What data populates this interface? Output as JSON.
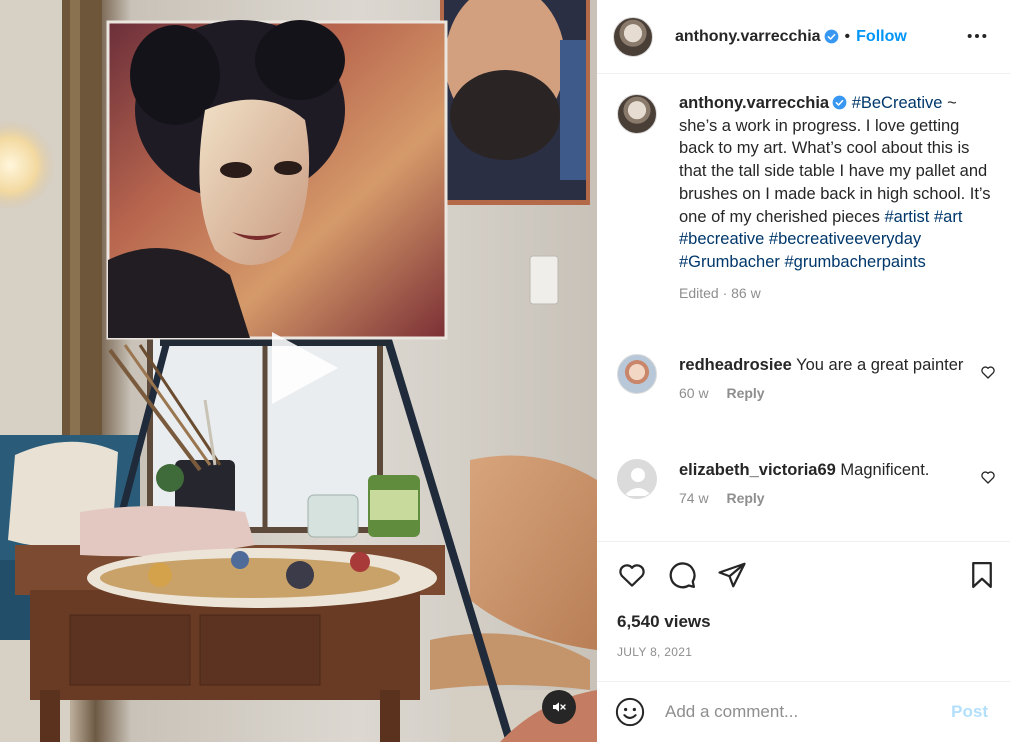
{
  "post": {
    "username": "anthony.varrecchia",
    "follow_label": "Follow",
    "separator": "•",
    "caption_hashtag_lead": "#BeCreative",
    "caption_text": " ~ she’s a work in progress. I love getting back to my art. What’s cool about this is that the tall side table I have my pallet and brushes on I made back in high school. It’s one of my cherished pieces ",
    "caption_tags": [
      "#artist",
      "#art",
      "#becreative",
      "#becreativeeveryday",
      "#Grumbacher",
      "#grumbacherpaints"
    ],
    "caption_meta": "Edited · 86 w"
  },
  "comments": [
    {
      "username": "redheadrosiee",
      "text": "You are a great painter",
      "time": "60 w",
      "reply_label": "Reply"
    },
    {
      "username": "elizabeth_victoria69",
      "text": "Magnificent.",
      "time": "74 w",
      "reply_label": "Reply"
    }
  ],
  "stats": {
    "views": "6,540 views",
    "date": "JULY 8, 2021"
  },
  "composer": {
    "placeholder": "Add a comment...",
    "post_label": "Post"
  },
  "colors": {
    "accent": "#0095f6",
    "hashtag": "#00376b",
    "muted": "#8e8e8e",
    "post_disabled": "#b2dffc"
  },
  "icons": {
    "media": [
      "play-icon",
      "mute-icon"
    ],
    "header": [
      "verified-badge-icon",
      "more-options-icon"
    ],
    "actions": [
      "heart-icon",
      "comment-icon",
      "share-icon",
      "bookmark-icon"
    ],
    "composer": [
      "emoji-icon"
    ]
  }
}
